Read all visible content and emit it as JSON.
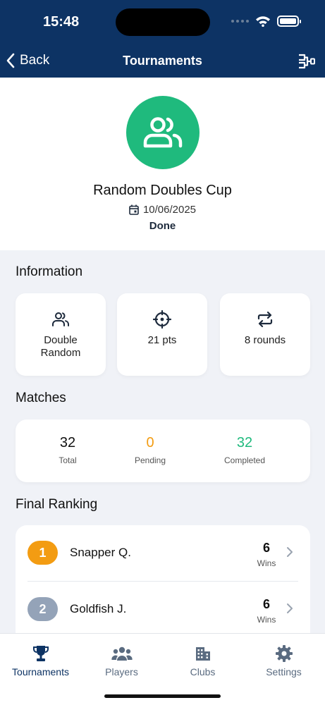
{
  "status": {
    "time": "15:48"
  },
  "nav": {
    "back_label": "Back",
    "title": "Tournaments"
  },
  "tournament": {
    "name": "Random Doubles Cup",
    "date": "10/06/2025",
    "status": "Done"
  },
  "information": {
    "title": "Information",
    "cards": [
      {
        "icon": "users-icon",
        "text": "Double Random"
      },
      {
        "icon": "target-icon",
        "text": "21 pts"
      },
      {
        "icon": "repeat-icon",
        "text": "8 rounds"
      }
    ]
  },
  "matches": {
    "title": "Matches",
    "stats": [
      {
        "value": "32",
        "label": "Total",
        "color": "#111111"
      },
      {
        "value": "0",
        "label": "Pending",
        "color": "#f39c12"
      },
      {
        "value": "32",
        "label": "Completed",
        "color": "#1fba7d"
      }
    ]
  },
  "ranking": {
    "title": "Final Ranking",
    "rows": [
      {
        "rank": "1",
        "name": "Snapper Q.",
        "wins": "6",
        "wins_label": "Wins",
        "badge_color": "#f39c12"
      },
      {
        "rank": "2",
        "name": "Goldfish J.",
        "wins": "6",
        "wins_label": "Wins",
        "badge_color": "#94a3b8"
      }
    ]
  },
  "tabs": [
    {
      "label": "Tournaments",
      "icon": "trophy-icon",
      "active": true
    },
    {
      "label": "Players",
      "icon": "players-icon",
      "active": false
    },
    {
      "label": "Clubs",
      "icon": "building-icon",
      "active": false
    },
    {
      "label": "Settings",
      "icon": "gear-icon",
      "active": false
    }
  ],
  "colors": {
    "nav_bg": "#0d3364",
    "accent_green": "#1fba7d",
    "accent_orange": "#f39c12"
  }
}
